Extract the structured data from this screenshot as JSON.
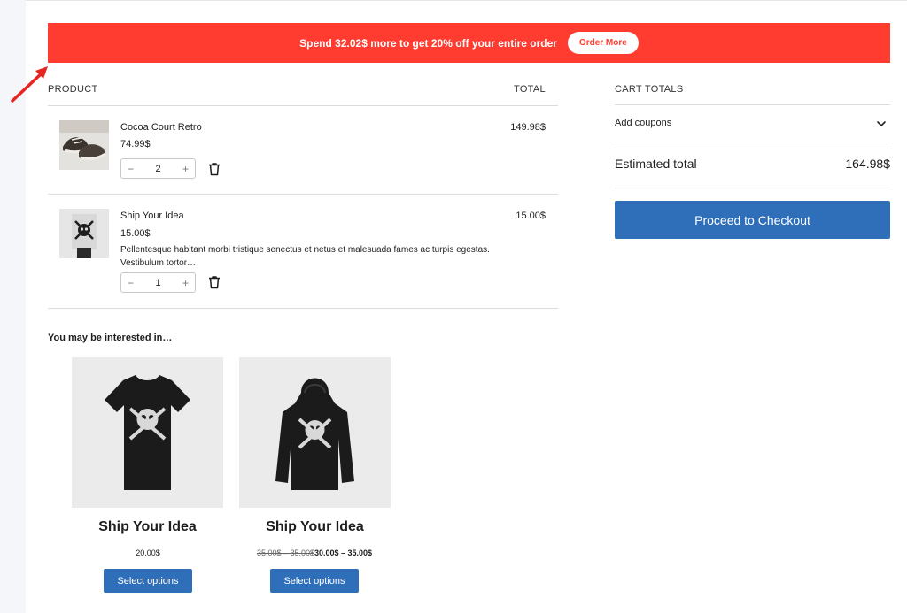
{
  "banner": {
    "message": "Spend 32.02$ more to get 20% off your entire order",
    "button_label": "Order More",
    "color": "#ff3c2f"
  },
  "cart": {
    "col_product": "PRODUCT",
    "col_total": "TOTAL",
    "items": [
      {
        "name": "Cocoa Court Retro",
        "price": "74.99$",
        "quantity": "2",
        "total": "149.98$",
        "description": ""
      },
      {
        "name": "Ship Your Idea",
        "price": "15.00$",
        "quantity": "1",
        "total": "15.00$",
        "description": "Pellentesque habitant morbi tristique senectus et netus et malesuada fames ac turpis egestas. Vestibulum tortor…"
      }
    ]
  },
  "crosssell": {
    "title": "You may be interested in…",
    "products": [
      {
        "name": "Ship Your Idea",
        "price": "20.00$",
        "button_label": "Select options"
      },
      {
        "name": "Ship Your Idea",
        "price_old": "35.00$ – 35.00$",
        "price_new": "30.00$ – 35.00$",
        "button_label": "Select options"
      }
    ]
  },
  "totals": {
    "heading": "CART TOTALS",
    "coupons_label": "Add coupons",
    "estimated_label": "Estimated total",
    "estimated_value": "164.98$",
    "checkout_label": "Proceed to Checkout",
    "button_color": "#2f6fba"
  },
  "icons": {
    "decrease": "−",
    "increase": "+",
    "trash": "trash-icon",
    "chevron": "chevron-down-icon"
  }
}
